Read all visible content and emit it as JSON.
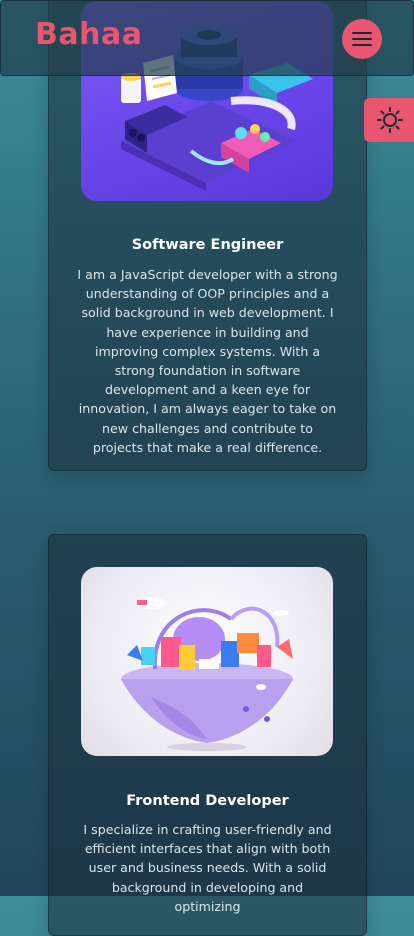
{
  "header": {
    "logo": "Bahaa",
    "menu_icon": "hamburger-icon"
  },
  "theme_toggle": {
    "icon": "sun-icon"
  },
  "colors": {
    "accent": "#e8566f",
    "card_bg": "#1c2c3c",
    "text": "#dbe5ea"
  },
  "cards": [
    {
      "image": "isometric-developer-workstation-illustration",
      "title": "Software Engineer",
      "text": "I am a JavaScript developer with a strong understanding of OOP principles and a solid background in web development. I have experience in building and improving complex systems. With a strong foundation in software development and a keen eye for innovation, I am always eager to take on new challenges and contribute to projects that make a real difference."
    },
    {
      "image": "floating-island-ui-illustration",
      "title": "Frontend Developer",
      "text": "I specialize in crafting user-friendly and efficient interfaces that align with both user and business needs. With a solid background in developing and optimizing"
    }
  ]
}
